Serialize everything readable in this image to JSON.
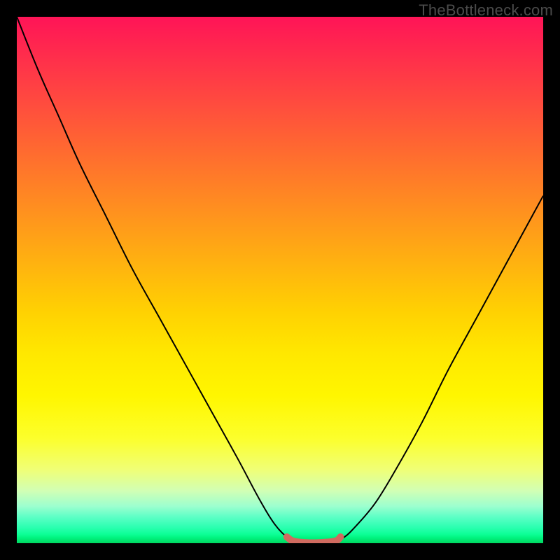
{
  "watermark": "TheBottleneck.com",
  "chart_data": {
    "type": "line",
    "title": "",
    "xlabel": "",
    "ylabel": "",
    "xlim": [
      0,
      1
    ],
    "ylim": [
      0,
      1
    ],
    "series": [
      {
        "name": "bottleneck-curve",
        "x": [
          0.0,
          0.04,
          0.08,
          0.12,
          0.17,
          0.22,
          0.27,
          0.32,
          0.37,
          0.42,
          0.46,
          0.49,
          0.515,
          0.53,
          0.55,
          0.58,
          0.605,
          0.62,
          0.64,
          0.68,
          0.72,
          0.77,
          0.82,
          0.88,
          0.94,
          1.0
        ],
        "y": [
          1.0,
          0.9,
          0.81,
          0.72,
          0.62,
          0.52,
          0.43,
          0.34,
          0.25,
          0.16,
          0.085,
          0.036,
          0.01,
          0.003,
          0.001,
          0.001,
          0.003,
          0.01,
          0.028,
          0.075,
          0.14,
          0.23,
          0.33,
          0.44,
          0.55,
          0.66
        ]
      },
      {
        "name": "floor-bar",
        "x": [
          0.513,
          0.525,
          0.55,
          0.575,
          0.605,
          0.615
        ],
        "y": [
          0.012,
          0.004,
          0.001,
          0.001,
          0.004,
          0.012
        ]
      }
    ],
    "colors": {
      "curve": "#000000",
      "floor_bar": "#d06a5f"
    }
  }
}
